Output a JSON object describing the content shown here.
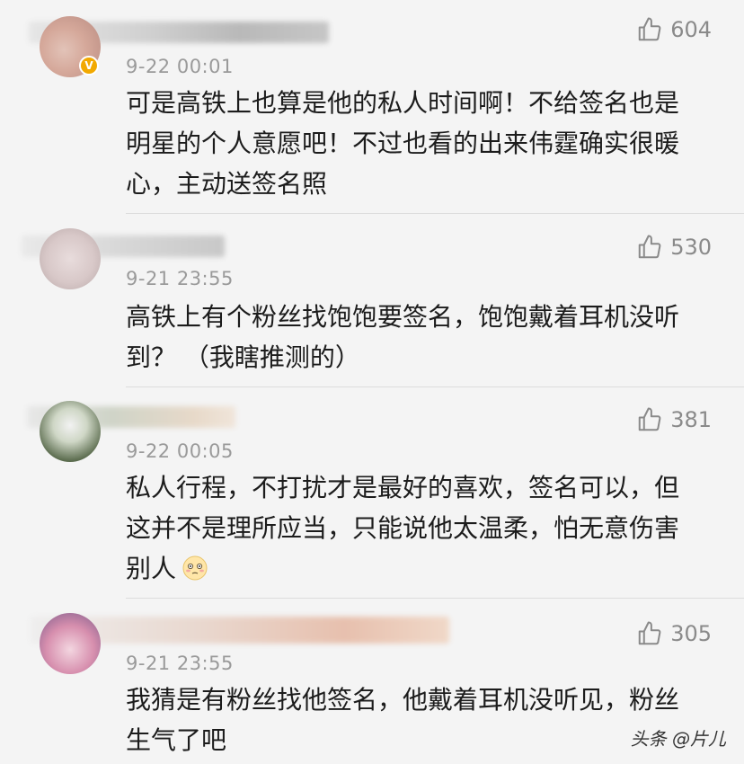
{
  "comments": [
    {
      "likes": "604",
      "time": "9-22 00:01",
      "text": "可是高铁上也算是他的私人时间啊！不给签名也是明星的个人意愿吧！不过也看的出来伟霆确实很暖心，主动送签名照"
    },
    {
      "likes": "530",
      "time": "9-21 23:55",
      "text": "高铁上有个粉丝找饱饱要签名，饱饱戴着耳机没听到？ （我瞎推测的）"
    },
    {
      "likes": "381",
      "time": "9-22 00:05",
      "text": "私人行程，不打扰才是最好的喜欢，签名可以，但这并不是理所应当，只能说他太温柔，怕无意伤害别人"
    },
    {
      "likes": "305",
      "time": "9-21 23:55",
      "text": "我猜是有粉丝找他签名，他戴着耳机没听见，粉丝生气了吧"
    }
  ],
  "watermark": "头条 @片儿",
  "colors": {
    "background": "#f4f4f4",
    "text": "#1c1c1c",
    "meta": "#9a9a9a",
    "verify_badge": "#f2a900"
  },
  "icons": {
    "like": "thumbs-up-icon",
    "verified": "verified-badge-icon",
    "emoji": "flushed-face-emoji"
  }
}
